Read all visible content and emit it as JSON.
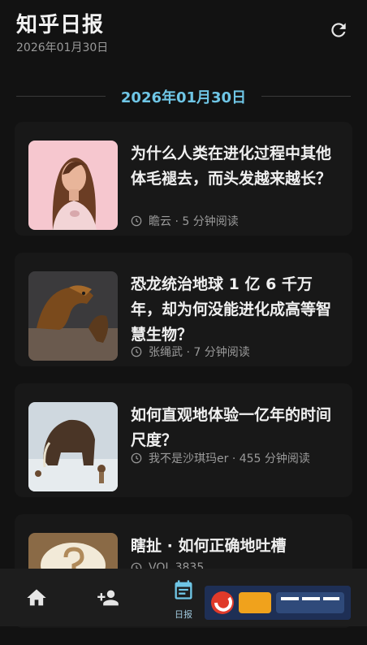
{
  "header": {
    "title": "知乎日报",
    "date": "2026年01月30日"
  },
  "section": {
    "date_label": "2026年01月30日"
  },
  "stories": [
    {
      "title": "为什么人类在进化过程中其他体毛褪去，而头发越来越长？",
      "meta": "瞻云 · 5 分钟阅读"
    },
    {
      "title": "恐龙统治地球 1 亿 6 千万年，却为何没能进化成高等智慧生物？",
      "meta": "张绳武 · 7 分钟阅读"
    },
    {
      "title": "如何直观地体验一亿年的时间尺度？",
      "meta": "我不是沙琪玛er · 455 分钟阅读"
    },
    {
      "title": "瞎扯 · 如何正确地吐槽",
      "meta": "VOL.3835"
    }
  ],
  "nav": {
    "daily_label": "日报"
  },
  "colors": {
    "accent": "#6fc6e6",
    "background": "#121212"
  },
  "icons": {
    "refresh": "refresh-icon",
    "clock": "clock-icon",
    "home": "home-icon",
    "add_friend": "add-user-icon",
    "daily": "calendar-icon"
  }
}
